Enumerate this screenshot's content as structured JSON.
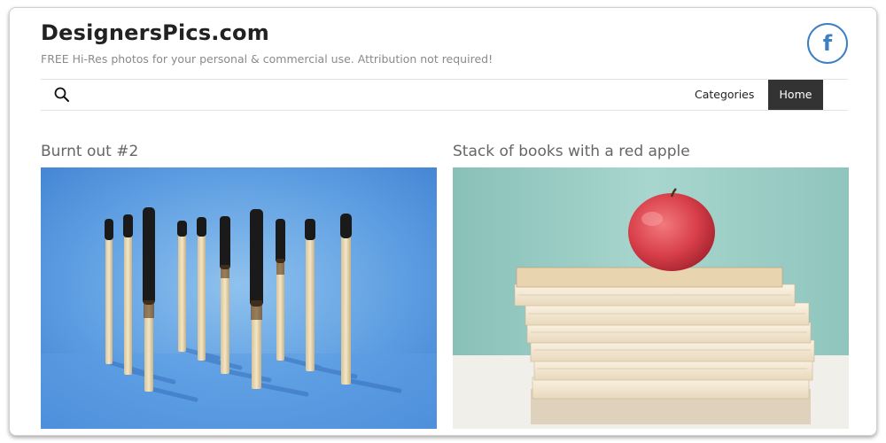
{
  "site": {
    "title": "DesignersPics.com",
    "tagline": "FREE Hi-Res photos for your personal & commercial use. Attribution not required!"
  },
  "social": {
    "facebook_label": "f",
    "icon": "facebook-icon",
    "color": "#3d7fc4"
  },
  "nav": {
    "search_icon": "search-icon",
    "items": [
      {
        "label": "Categories",
        "active": false
      },
      {
        "label": "Home",
        "active": true
      }
    ]
  },
  "posts": [
    {
      "title": "Burnt out #2",
      "image": "burnt matches standing on blue background"
    },
    {
      "title": "Stack of books with a red apple",
      "image": "red apple on a stack of books"
    }
  ]
}
